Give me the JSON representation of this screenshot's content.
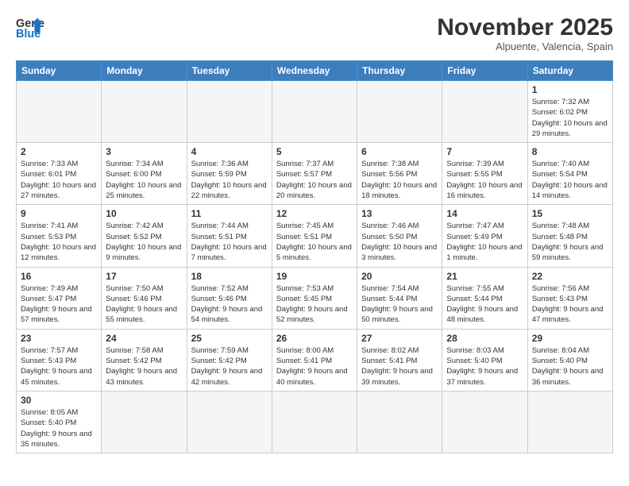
{
  "logo": {
    "line1": "General",
    "line2": "Blue"
  },
  "header": {
    "month": "November 2025",
    "location": "Alpuente, Valencia, Spain"
  },
  "days_of_week": [
    "Sunday",
    "Monday",
    "Tuesday",
    "Wednesday",
    "Thursday",
    "Friday",
    "Saturday"
  ],
  "weeks": [
    [
      {
        "date": "",
        "info": ""
      },
      {
        "date": "",
        "info": ""
      },
      {
        "date": "",
        "info": ""
      },
      {
        "date": "",
        "info": ""
      },
      {
        "date": "",
        "info": ""
      },
      {
        "date": "",
        "info": ""
      },
      {
        "date": "1",
        "info": "Sunrise: 7:32 AM\nSunset: 6:02 PM\nDaylight: 10 hours and 29 minutes."
      }
    ],
    [
      {
        "date": "2",
        "info": "Sunrise: 7:33 AM\nSunset: 6:01 PM\nDaylight: 10 hours and 27 minutes."
      },
      {
        "date": "3",
        "info": "Sunrise: 7:34 AM\nSunset: 6:00 PM\nDaylight: 10 hours and 25 minutes."
      },
      {
        "date": "4",
        "info": "Sunrise: 7:36 AM\nSunset: 5:59 PM\nDaylight: 10 hours and 22 minutes."
      },
      {
        "date": "5",
        "info": "Sunrise: 7:37 AM\nSunset: 5:57 PM\nDaylight: 10 hours and 20 minutes."
      },
      {
        "date": "6",
        "info": "Sunrise: 7:38 AM\nSunset: 5:56 PM\nDaylight: 10 hours and 18 minutes."
      },
      {
        "date": "7",
        "info": "Sunrise: 7:39 AM\nSunset: 5:55 PM\nDaylight: 10 hours and 16 minutes."
      },
      {
        "date": "8",
        "info": "Sunrise: 7:40 AM\nSunset: 5:54 PM\nDaylight: 10 hours and 14 minutes."
      }
    ],
    [
      {
        "date": "9",
        "info": "Sunrise: 7:41 AM\nSunset: 5:53 PM\nDaylight: 10 hours and 12 minutes."
      },
      {
        "date": "10",
        "info": "Sunrise: 7:42 AM\nSunset: 5:52 PM\nDaylight: 10 hours and 9 minutes."
      },
      {
        "date": "11",
        "info": "Sunrise: 7:44 AM\nSunset: 5:51 PM\nDaylight: 10 hours and 7 minutes."
      },
      {
        "date": "12",
        "info": "Sunrise: 7:45 AM\nSunset: 5:51 PM\nDaylight: 10 hours and 5 minutes."
      },
      {
        "date": "13",
        "info": "Sunrise: 7:46 AM\nSunset: 5:50 PM\nDaylight: 10 hours and 3 minutes."
      },
      {
        "date": "14",
        "info": "Sunrise: 7:47 AM\nSunset: 5:49 PM\nDaylight: 10 hours and 1 minute."
      },
      {
        "date": "15",
        "info": "Sunrise: 7:48 AM\nSunset: 5:48 PM\nDaylight: 9 hours and 59 minutes."
      }
    ],
    [
      {
        "date": "16",
        "info": "Sunrise: 7:49 AM\nSunset: 5:47 PM\nDaylight: 9 hours and 57 minutes."
      },
      {
        "date": "17",
        "info": "Sunrise: 7:50 AM\nSunset: 5:46 PM\nDaylight: 9 hours and 55 minutes."
      },
      {
        "date": "18",
        "info": "Sunrise: 7:52 AM\nSunset: 5:46 PM\nDaylight: 9 hours and 54 minutes."
      },
      {
        "date": "19",
        "info": "Sunrise: 7:53 AM\nSunset: 5:45 PM\nDaylight: 9 hours and 52 minutes."
      },
      {
        "date": "20",
        "info": "Sunrise: 7:54 AM\nSunset: 5:44 PM\nDaylight: 9 hours and 50 minutes."
      },
      {
        "date": "21",
        "info": "Sunrise: 7:55 AM\nSunset: 5:44 PM\nDaylight: 9 hours and 48 minutes."
      },
      {
        "date": "22",
        "info": "Sunrise: 7:56 AM\nSunset: 5:43 PM\nDaylight: 9 hours and 47 minutes."
      }
    ],
    [
      {
        "date": "23",
        "info": "Sunrise: 7:57 AM\nSunset: 5:43 PM\nDaylight: 9 hours and 45 minutes."
      },
      {
        "date": "24",
        "info": "Sunrise: 7:58 AM\nSunset: 5:42 PM\nDaylight: 9 hours and 43 minutes."
      },
      {
        "date": "25",
        "info": "Sunrise: 7:59 AM\nSunset: 5:42 PM\nDaylight: 9 hours and 42 minutes."
      },
      {
        "date": "26",
        "info": "Sunrise: 8:00 AM\nSunset: 5:41 PM\nDaylight: 9 hours and 40 minutes."
      },
      {
        "date": "27",
        "info": "Sunrise: 8:02 AM\nSunset: 5:41 PM\nDaylight: 9 hours and 39 minutes."
      },
      {
        "date": "28",
        "info": "Sunrise: 8:03 AM\nSunset: 5:40 PM\nDaylight: 9 hours and 37 minutes."
      },
      {
        "date": "29",
        "info": "Sunrise: 8:04 AM\nSunset: 5:40 PM\nDaylight: 9 hours and 36 minutes."
      }
    ],
    [
      {
        "date": "30",
        "info": "Sunrise: 8:05 AM\nSunset: 5:40 PM\nDaylight: 9 hours and 35 minutes."
      },
      {
        "date": "",
        "info": ""
      },
      {
        "date": "",
        "info": ""
      },
      {
        "date": "",
        "info": ""
      },
      {
        "date": "",
        "info": ""
      },
      {
        "date": "",
        "info": ""
      },
      {
        "date": "",
        "info": ""
      }
    ]
  ]
}
